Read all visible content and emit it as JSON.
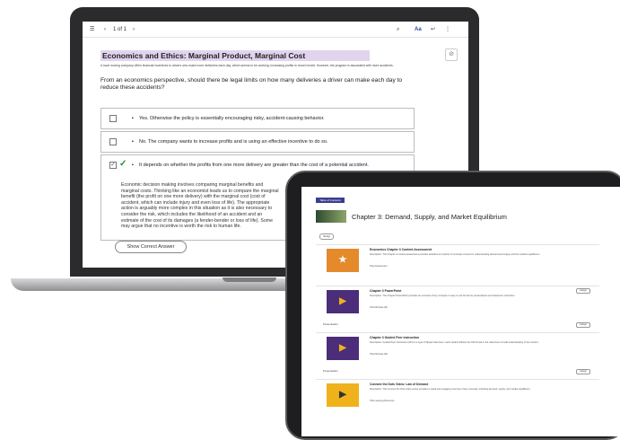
{
  "laptop": {
    "toolbar": {
      "menu_icon": "menu-icon",
      "page_label": "1 of 1",
      "prev": "‹",
      "next": "›",
      "search_icon": "⌕",
      "font_label": "Aa",
      "more": "⋮"
    },
    "title": "Economics and Ethics: Marginal Product, Marginal Cost",
    "intro": "A local moving company offers financial incentives to drivers who make more deliveries each day, which seems to be working; increasing profits to record levels. However, the program is associated with more accidents.",
    "question": "From an economics perspective, should there be legal limits on how many deliveries a driver can make each day to reduce these accidents?",
    "options": [
      {
        "text": "Yes. Otherwise the policy is essentially encouraging risky, accident-causing behavior."
      },
      {
        "text": "No. The company wants to increase profits and is using an effective incentive to do so."
      },
      {
        "text": "It depends on whether the profits from one more delivery are greater than the cost of a potential accident."
      }
    ],
    "explanation": "Economic decision making involves comparing marginal benefits and marginal costs. Thinking like an economist leads us to compare the marginal benefit (the profit on one more delivery) with the marginal cost (cost of accident, which can include injury and even loss of life). The appropriate action is arguably more complex in this situation as it is also necessary to consider the risk, which includes the likelihood of an accident and an estimate of the cost of its damages (a fender-bender or loss of life). Some may argue that no incentive is worth the risk to human life.",
    "show_button": "Show Correct Answer",
    "corner_icon": "⊘"
  },
  "tablet": {
    "tag": "Table of Contents",
    "title": "Chapter 3: Demand, Supply, and Market Equilibrium",
    "pill": "Setup",
    "cards": [
      {
        "name": "Economics Chapter 3 Content Assessment",
        "desc": "Description: The Chapter 3 content assessment provides activities for practice of concepts covered in understanding demand and supply and the markets equilibrium.",
        "meta": "Title   Assessment",
        "color": "#e58a2b"
      },
      {
        "name": "Chapter 3 PowerPoint",
        "desc": "Description: The Chapter PowerPoint provides an overview of key concepts in easy to use format for presentations and classroom instruction.",
        "meta": "Title   McGraw-Hill",
        "color": "#4b2d7a",
        "side": "Presentation"
      },
      {
        "name": "Chapter 3 Guided Peer Instruction",
        "desc": "Description: Guided Peer Instruction (GPI) is a type of flipped classroom; each student follows the GPI format in the classroom to build understanding of the content.",
        "meta": "Title   McGraw-Hill",
        "color": "#4b2d7a",
        "side": "Presentation"
      },
      {
        "name": "Connect the Dots Video: Law of Demand",
        "desc": "Description: The Connect the Dots video series provides a visual and engaging overview of key concepts, including demand, supply, and market equilibrium.",
        "meta": "Title   Learning Resource",
        "color": "#f0b21c"
      }
    ],
    "action_label": "Assign"
  }
}
